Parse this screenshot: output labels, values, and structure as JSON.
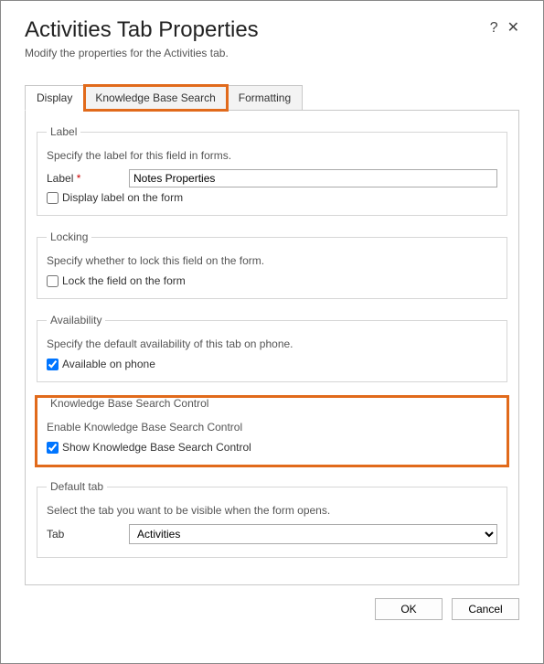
{
  "header": {
    "title": "Activities Tab Properties",
    "subtitle": "Modify the properties for the Activities tab."
  },
  "tabs": {
    "display": "Display",
    "kb": "Knowledge Base Search",
    "formatting": "Formatting"
  },
  "label_section": {
    "legend": "Label",
    "desc": "Specify the label for this field in forms.",
    "label_text": "Label",
    "label_value": "Notes Properties",
    "display_label_chk": "Display label on the form"
  },
  "locking_section": {
    "legend": "Locking",
    "desc": "Specify whether to lock this field on the form.",
    "lock_chk": "Lock the field on the form"
  },
  "availability_section": {
    "legend": "Availability",
    "desc": "Specify the default availability of this tab on phone.",
    "avail_chk": "Available on phone"
  },
  "kb_section": {
    "legend": "Knowledge Base Search Control",
    "desc": "Enable Knowledge Base Search Control",
    "kb_chk": "Show Knowledge Base Search Control"
  },
  "default_tab_section": {
    "legend": "Default tab",
    "desc": "Select the tab you want to be visible when the form opens.",
    "tab_label": "Tab",
    "tab_value": "Activities"
  },
  "footer": {
    "ok": "OK",
    "cancel": "Cancel"
  }
}
